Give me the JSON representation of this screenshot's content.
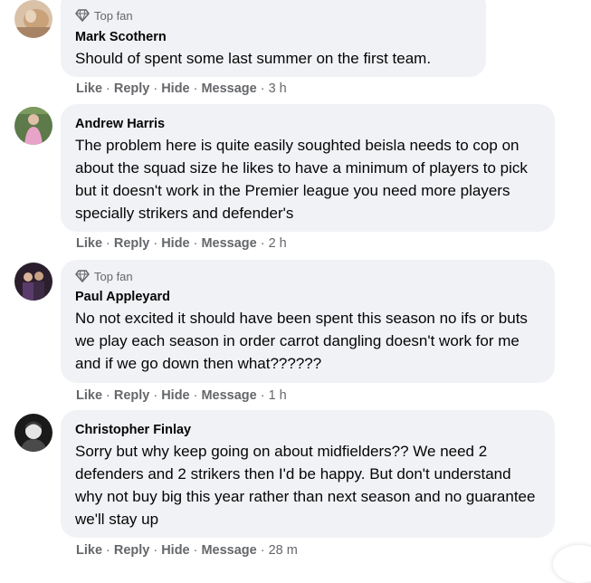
{
  "comments": [
    {
      "badge": "Top fan",
      "author": "Mark Scothern",
      "text": "Should of spent some last summer on the first team.",
      "actions": {
        "like": "Like",
        "reply": "Reply",
        "hide": "Hide",
        "message": "Message",
        "time": "3 h"
      }
    },
    {
      "badge": "",
      "author": "Andrew Harris",
      "text": "The problem here is quite easily soughted beisla needs to cop on about the squad size he likes to have a minimum of players to pick but it doesn't work in the Premier league you need more players specially strikers and defender's",
      "actions": {
        "like": "Like",
        "reply": "Reply",
        "hide": "Hide",
        "message": "Message",
        "time": "2 h"
      }
    },
    {
      "badge": "Top fan",
      "author": "Paul Appleyard",
      "text": "No not excited it should have been spent this season no ifs or buts we play each season in order carrot dangling doesn't work for me and if we go down then what??????",
      "actions": {
        "like": "Like",
        "reply": "Reply",
        "hide": "Hide",
        "message": "Message",
        "time": "1 h"
      }
    },
    {
      "badge": "",
      "author": "Christopher Finlay",
      "text": "Sorry but why keep going on about midfielders?? We need 2 defenders and 2 strikers then I'd be happy. But don't understand why not buy big this year rather than next season and no guarantee we'll stay up",
      "actions": {
        "like": "Like",
        "reply": "Reply",
        "hide": "Hide",
        "message": "Message",
        "time": "28 m"
      }
    }
  ],
  "colors": {
    "bubble": "#f0f2f5",
    "secondary_text": "#65676b",
    "primary_text": "#050505"
  },
  "icons": {
    "badge": "diamond-icon"
  }
}
